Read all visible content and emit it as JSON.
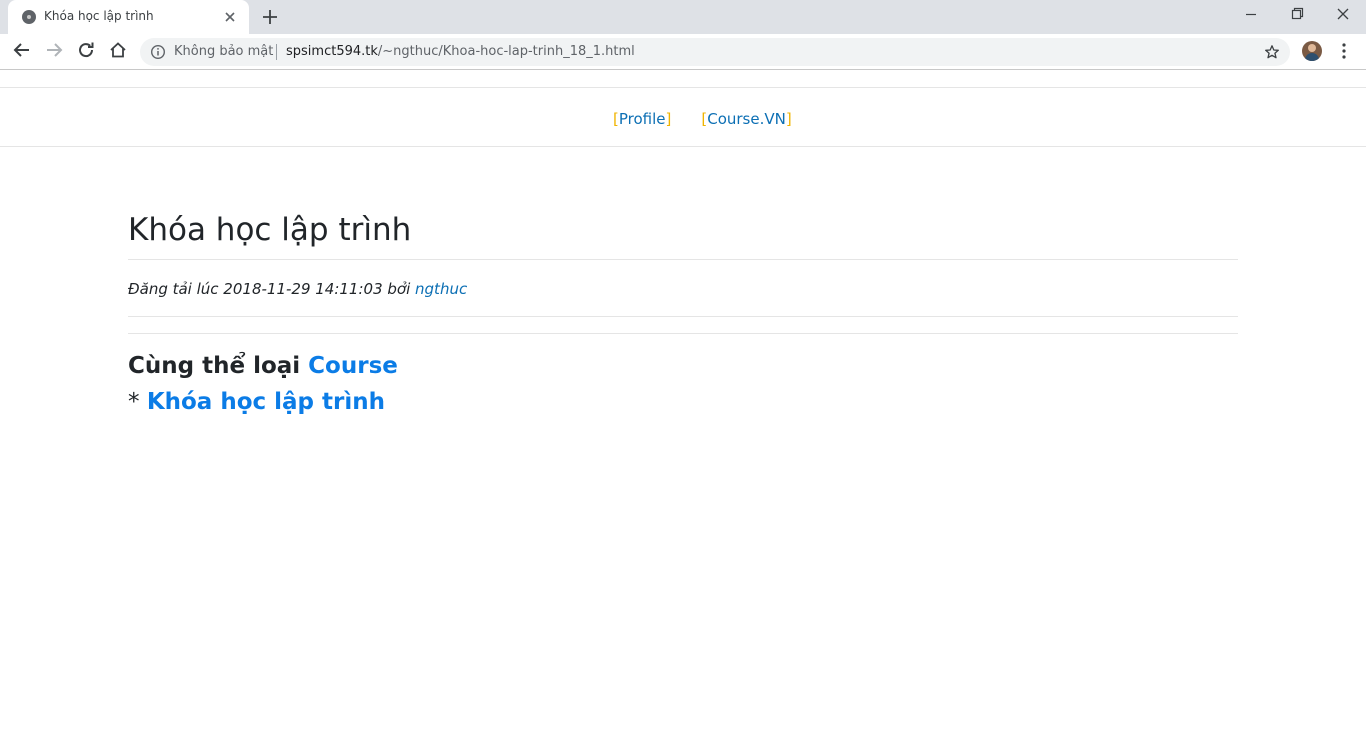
{
  "browser": {
    "tab": {
      "title": "Khóa học lập trình",
      "favicon_icon": "site-favicon-icon",
      "close_icon": "close-icon"
    },
    "new_tab_icon": "plus-icon",
    "window_controls": {
      "minimize_icon": "minimize-icon",
      "maximize_icon": "restore-icon",
      "close_icon": "close-icon"
    },
    "nav": {
      "back_icon": "back-arrow-icon",
      "forward_icon": "forward-arrow-icon",
      "reload_icon": "reload-icon",
      "home_icon": "home-icon"
    },
    "address_bar": {
      "security_label": "Không bảo mật",
      "url_host": "spsimct594.tk",
      "url_path": "/~ngthuc/Khoa-hoc-lap-trinh_18_1.html",
      "info_icon": "info-icon",
      "bookmark_icon": "star-icon"
    },
    "profile_icon": "avatar-icon",
    "menu_icon": "kebab-menu-icon"
  },
  "site_nav": {
    "links": [
      {
        "open": "[",
        "label": "Profile",
        "close": "]"
      },
      {
        "open": "[",
        "label": "Course.VN",
        "close": "]"
      }
    ]
  },
  "article": {
    "title": "Khóa học lập trình",
    "meta_prefix": "Đăng tải lúc 2018-11-29 14:11:03 bởi ",
    "author": "ngthuc"
  },
  "related": {
    "heading_prefix": "Cùng thể loại ",
    "category": "Course",
    "bullet": "* ",
    "items": [
      "Khóa học lập trình"
    ]
  },
  "colors": {
    "link": "#0c6fb4",
    "link_strong": "#0b7ce6",
    "bracket": "#f0b400",
    "tabstrip": "#dee1e6",
    "text": "#212529"
  }
}
